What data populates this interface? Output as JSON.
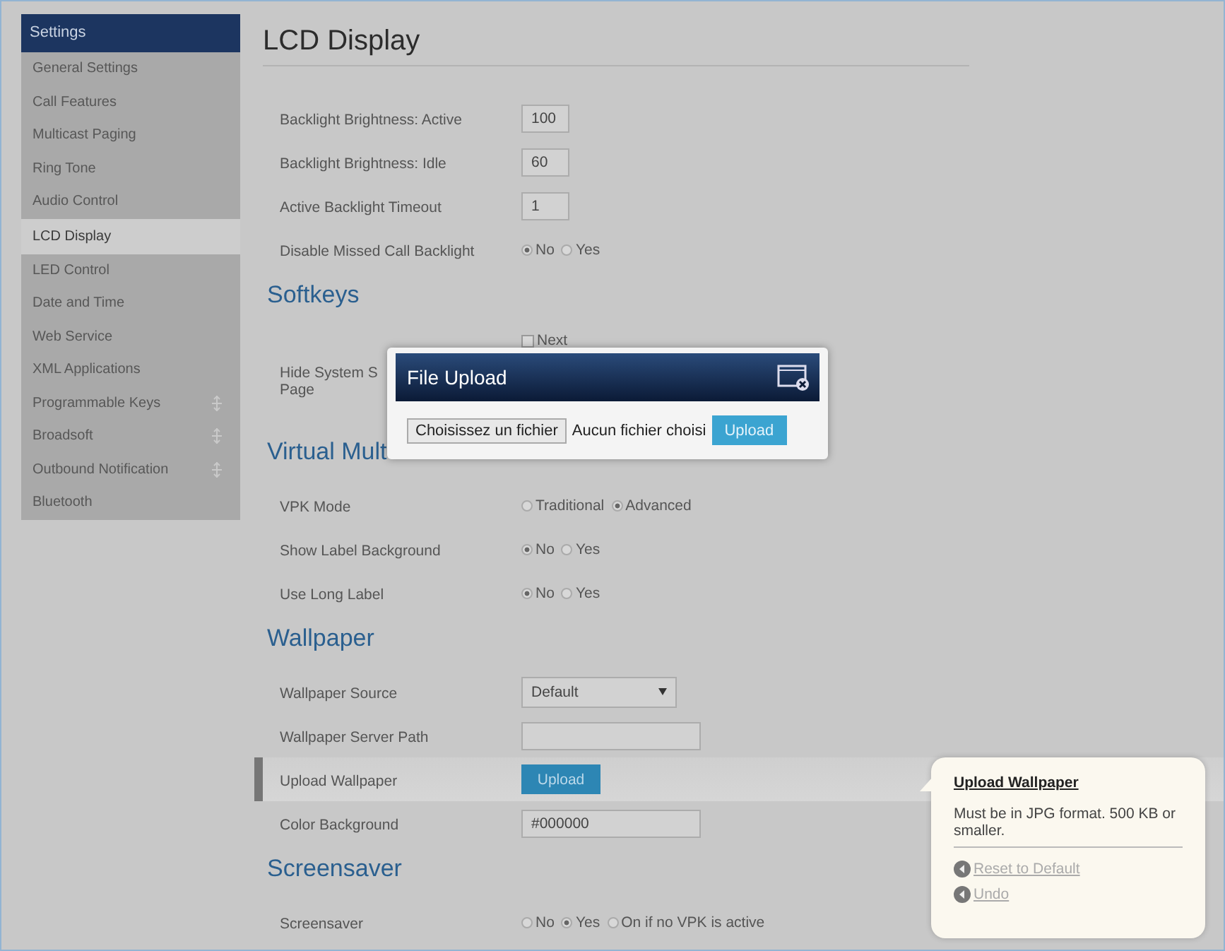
{
  "sidebar": {
    "header": "Settings",
    "items": [
      {
        "label": "General Settings",
        "selected": false,
        "expandable": false
      },
      {
        "label": "Call Features",
        "selected": false,
        "expandable": false
      },
      {
        "label": "Multicast Paging",
        "selected": false,
        "expandable": false
      },
      {
        "label": "Ring Tone",
        "selected": false,
        "expandable": false
      },
      {
        "label": "Audio Control",
        "selected": false,
        "expandable": false
      },
      {
        "label": "LCD Display",
        "selected": true,
        "expandable": false
      },
      {
        "label": "LED Control",
        "selected": false,
        "expandable": false
      },
      {
        "label": "Date and Time",
        "selected": false,
        "expandable": false
      },
      {
        "label": "Web Service",
        "selected": false,
        "expandable": false
      },
      {
        "label": "XML Applications",
        "selected": false,
        "expandable": false
      },
      {
        "label": "Programmable Keys",
        "selected": false,
        "expandable": true
      },
      {
        "label": "Broadsoft",
        "selected": false,
        "expandable": true
      },
      {
        "label": "Outbound Notification",
        "selected": false,
        "expandable": true
      },
      {
        "label": "Bluetooth",
        "selected": false,
        "expandable": false
      }
    ]
  },
  "page_title": "LCD Display",
  "sections": [
    {
      "rows": [
        {
          "label": "Backlight Brightness: Active",
          "kind": "input",
          "value": "100",
          "highlighted": false
        },
        {
          "label": "Backlight Brightness: Idle",
          "kind": "input",
          "value": "60",
          "highlighted": false
        },
        {
          "label": "Active Backlight Timeout",
          "kind": "input",
          "value": "1",
          "highlighted": false
        },
        {
          "label": "Disable Missed Call Backlight",
          "kind": "radio",
          "options": [
            {
              "label": "No",
              "selected": true
            },
            {
              "label": "Yes",
              "selected": false
            }
          ],
          "highlighted": false
        }
      ]
    },
    {
      "heading": "Softkeys",
      "rows": [
        {
          "label": "Hide System S\nPage",
          "kind": "checkboxes",
          "options": [
            {
              "label": "Next",
              "checked": false
            }
          ],
          "highlighted": false
        }
      ]
    },
    {
      "heading": "Virtual Mult",
      "rows": [
        {
          "label": "VPK Mode",
          "kind": "radio",
          "options": [
            {
              "label": "Traditional",
              "selected": false
            },
            {
              "label": "Advanced",
              "selected": true
            }
          ],
          "highlighted": false
        },
        {
          "label": "Show Label Background",
          "kind": "radio",
          "options": [
            {
              "label": "No",
              "selected": true
            },
            {
              "label": "Yes",
              "selected": false
            }
          ],
          "highlighted": false
        },
        {
          "label": "Use Long Label",
          "kind": "radio",
          "options": [
            {
              "label": "No",
              "selected": true
            },
            {
              "label": "Yes",
              "selected": false
            }
          ],
          "highlighted": false
        }
      ]
    },
    {
      "heading": "Wallpaper",
      "rows": [
        {
          "label": "Wallpaper Source",
          "kind": "select",
          "value": "Default",
          "highlighted": false
        },
        {
          "label": "Wallpaper Server Path",
          "kind": "input",
          "value": "",
          "highlighted": false,
          "wide": true
        },
        {
          "label": "Upload Wallpaper",
          "kind": "button",
          "value": "Upload",
          "highlighted": true
        },
        {
          "label": "Color Background",
          "kind": "input",
          "value": "#000000",
          "highlighted": false,
          "wide": true
        }
      ]
    },
    {
      "heading": "Screensaver",
      "rows": [
        {
          "label": "Screensaver",
          "kind": "radio",
          "options": [
            {
              "label": "No",
              "selected": false
            },
            {
              "label": "Yes",
              "selected": true
            },
            {
              "label": "On if no VPK is active",
              "selected": false
            }
          ],
          "highlighted": false
        }
      ]
    }
  ],
  "dialog": {
    "title": "File Upload",
    "choose_button": "Choisissez un fichier",
    "file_status": "Aucun fichier choisi",
    "upload_button": "Upload"
  },
  "tooltip": {
    "title": "Upload Wallpaper",
    "text": "Must be in JPG format. 500 KB or smaller.",
    "links": [
      "Reset to Default",
      "Undo"
    ]
  }
}
